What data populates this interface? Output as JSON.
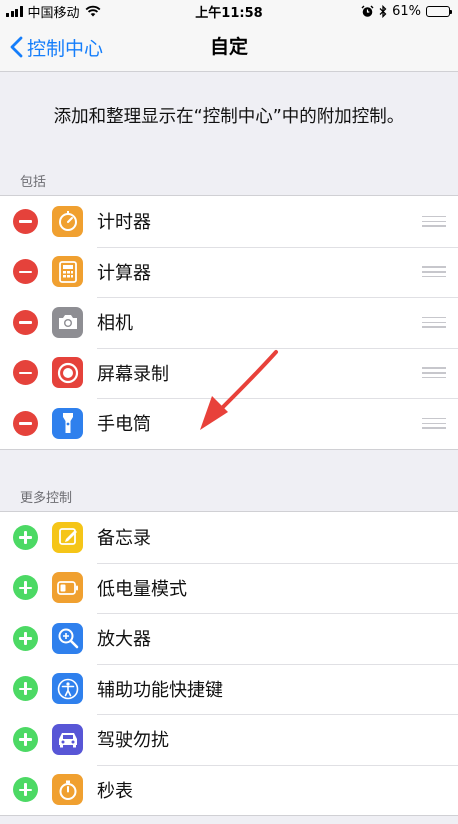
{
  "status_bar": {
    "carrier": "中国移动",
    "time": "上午11:58",
    "battery_percent": "61%",
    "battery_level": 0.61,
    "icons": [
      "signal-icon",
      "wifi-icon",
      "alarm-icon",
      "bluetooth-icon",
      "battery-icon"
    ]
  },
  "nav": {
    "back_label": "控制中心",
    "title": "自定"
  },
  "description": "添加和整理显示在“控制中心”中的附加控制。",
  "included": {
    "header": "包括",
    "items": [
      {
        "label": "计时器",
        "icon": "timer-icon",
        "color": "#f0a030"
      },
      {
        "label": "计算器",
        "icon": "calculator-icon",
        "color": "#f0a030"
      },
      {
        "label": "相机",
        "icon": "camera-icon",
        "color": "#8e8e93"
      },
      {
        "label": "屏幕录制",
        "icon": "screen-record-icon",
        "color": "#e5423b"
      },
      {
        "label": "手电筒",
        "icon": "flashlight-icon",
        "color": "#2f80ed"
      }
    ]
  },
  "more": {
    "header": "更多控制",
    "items": [
      {
        "label": "备忘录",
        "icon": "notes-icon",
        "color": "#f5c518"
      },
      {
        "label": "低电量模式",
        "icon": "low-power-icon",
        "color": "#f0a030"
      },
      {
        "label": "放大器",
        "icon": "magnifier-icon",
        "color": "#2f80ed"
      },
      {
        "label": "辅助功能快捷键",
        "icon": "accessibility-icon",
        "color": "#2f80ed"
      },
      {
        "label": "驾驶勿扰",
        "icon": "car-icon",
        "color": "#5856d6"
      },
      {
        "label": "秒表",
        "icon": "stopwatch-icon",
        "color": "#f0a030"
      }
    ]
  },
  "colors": {
    "accent": "#157efb",
    "remove": "#e5423b",
    "add": "#4cd964",
    "annotation_arrow": "#e8413a"
  }
}
